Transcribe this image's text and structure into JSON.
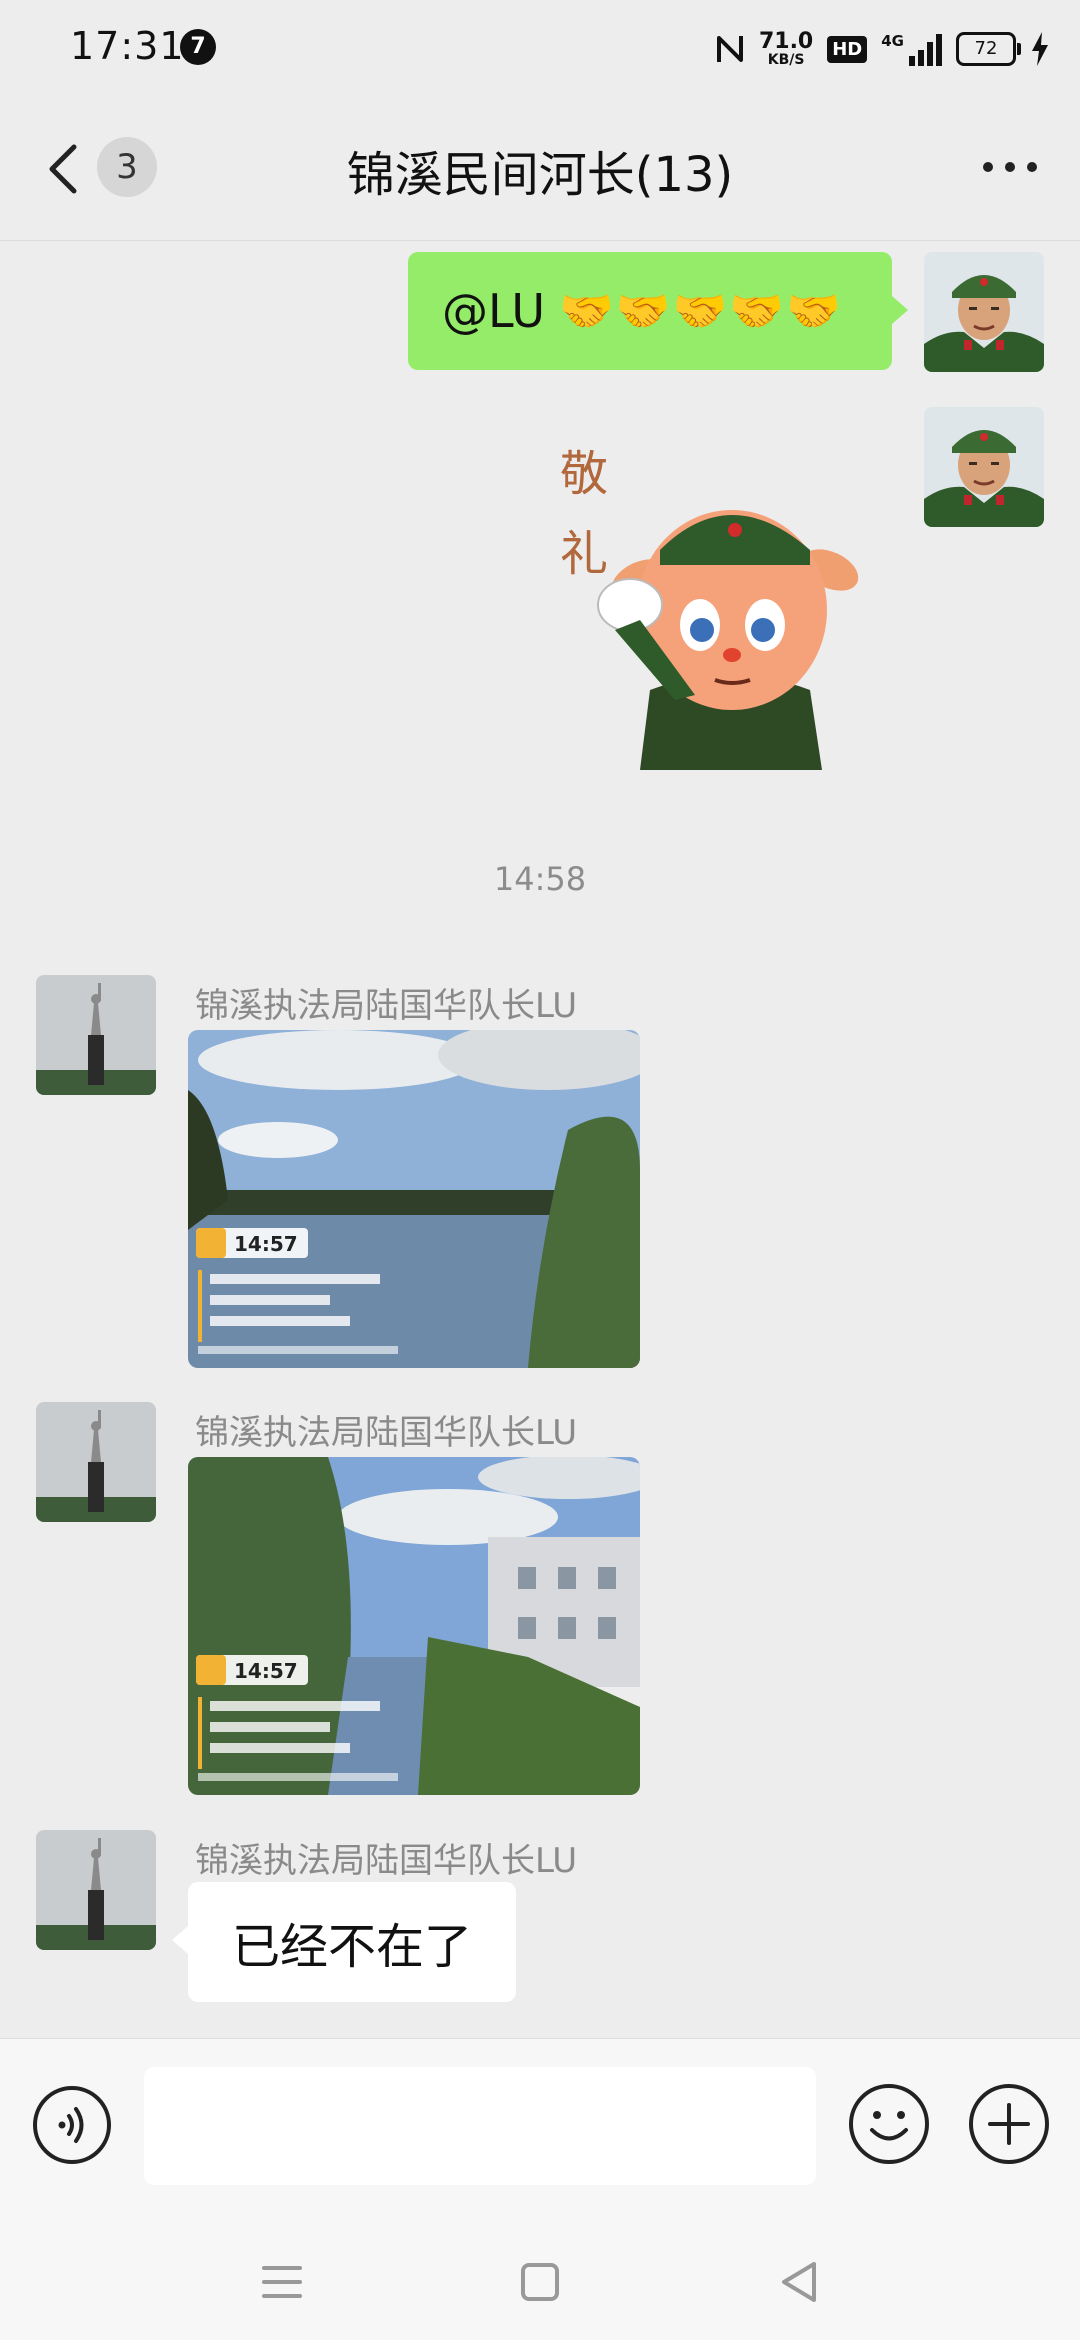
{
  "status_bar": {
    "time": "17:31",
    "notification_count": "7",
    "net_speed_value": "71.0",
    "net_speed_unit": "KB/S",
    "hd_label": "HD",
    "network_type": "4G",
    "battery_level": "72"
  },
  "header": {
    "unread_count": "3",
    "title": "锦溪民间河长(13)"
  },
  "messages": {
    "outgoing_text_prefix": "@LU",
    "outgoing_emoji": "🤝🤝🤝🤝🤝",
    "sticker_text": [
      "敬",
      "礼"
    ],
    "timestamp": "14:58",
    "sender_name": "锦溪执法局陆国华队长LU",
    "photo_1_stamp": "14:57",
    "photo_2_stamp": "14:57",
    "reply_text": "已经不在了"
  },
  "input_bar": {
    "placeholder": ""
  },
  "colors": {
    "outgoing_bubble": "#95ec69",
    "background": "#ededed"
  }
}
